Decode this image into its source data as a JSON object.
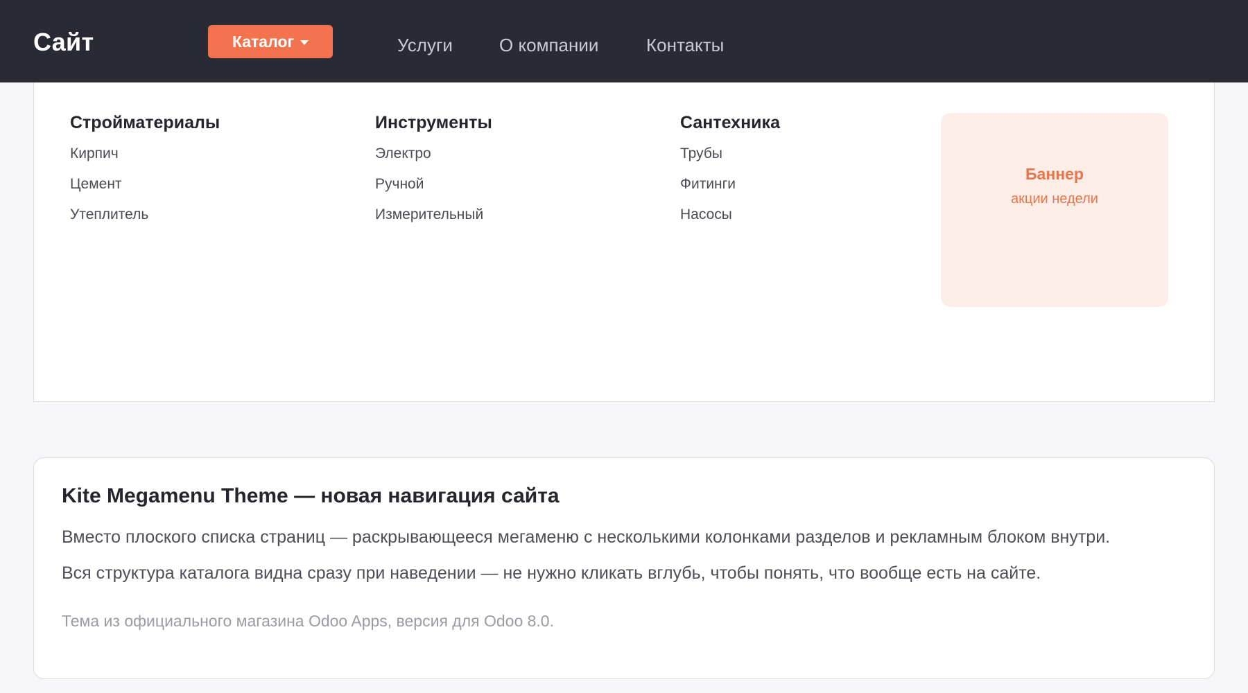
{
  "header": {
    "brand": "Сайт",
    "catalog_label": "Каталог",
    "nav": [
      "Услуги",
      "О компании",
      "Контакты"
    ]
  },
  "megamenu": {
    "columns": [
      {
        "title": "Стройматериалы",
        "items": [
          "Кирпич",
          "Цемент",
          "Утеплитель"
        ]
      },
      {
        "title": "Инструменты",
        "items": [
          "Электро",
          "Ручной",
          "Измерительный"
        ]
      },
      {
        "title": "Сантехника",
        "items": [
          "Трубы",
          "Фитинги",
          "Насосы"
        ]
      }
    ],
    "banner": {
      "title": "Баннер",
      "subtitle": "акции недели"
    }
  },
  "card": {
    "title": "Kite Megamenu Theme — новая навигация сайта",
    "paragraphs": [
      "Вместо плоского списка страниц — раскрывающееся мегаменю с несколькими колонками разделов и рекламным блоком внутри.",
      "Вся структура каталога видна сразу при наведении — не нужно кликать вглубь, чтобы понять, что вообще есть на сайте."
    ],
    "note": "Тема из официального магазина Odoo Apps, версия для Odoo 8.0."
  },
  "colors": {
    "navbar_bg": "#292a34",
    "accent": "#f2734d",
    "banner_bg": "#fcede7",
    "page_bg": "#f6f6f8"
  },
  "icons": {
    "catalog_caret": "caret-down-icon"
  }
}
